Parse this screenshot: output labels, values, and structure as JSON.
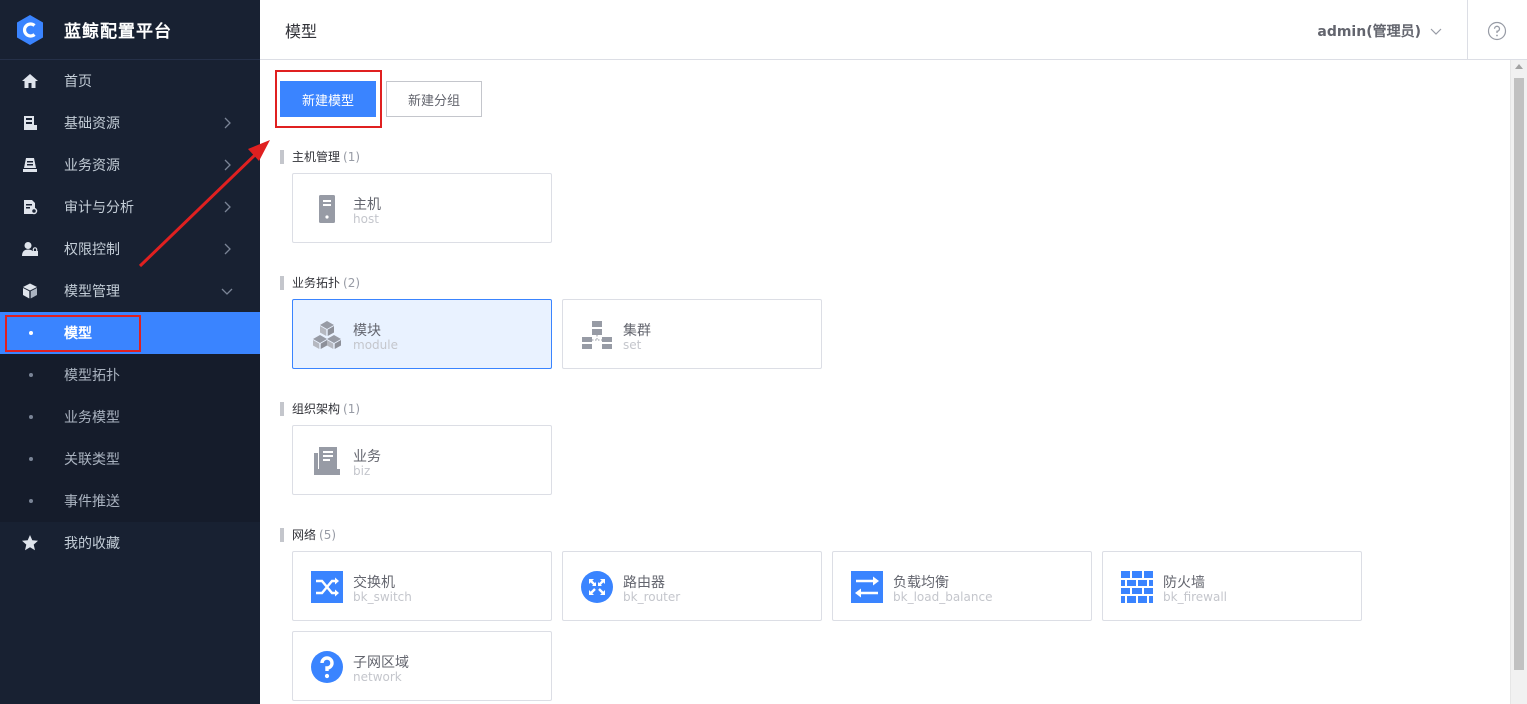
{
  "brand": {
    "name": "蓝鲸配置平台"
  },
  "sidebar": {
    "items": [
      {
        "label": "首页",
        "icon": "home-icon"
      },
      {
        "label": "基础资源",
        "icon": "resource-icon"
      },
      {
        "label": "业务资源",
        "icon": "business-resource-icon"
      },
      {
        "label": "审计与分析",
        "icon": "audit-icon"
      },
      {
        "label": "权限控制",
        "icon": "permission-icon"
      },
      {
        "label": "模型管理",
        "icon": "cube-icon"
      }
    ],
    "sub_items": [
      {
        "label": "模型"
      },
      {
        "label": "模型拓扑"
      },
      {
        "label": "业务模型"
      },
      {
        "label": "关联类型"
      },
      {
        "label": "事件推送"
      }
    ],
    "favorites": {
      "label": "我的收藏",
      "icon": "star-icon"
    }
  },
  "header": {
    "title": "模型",
    "user": "admin(管理员)"
  },
  "toolbar": {
    "new_model": "新建模型",
    "new_group": "新建分组"
  },
  "groups": [
    {
      "name": "主机管理",
      "count": "(1)",
      "models": [
        {
          "name": "主机",
          "id": "host",
          "icon": "host-icon"
        }
      ]
    },
    {
      "name": "业务拓扑",
      "count": "(2)",
      "models": [
        {
          "name": "模块",
          "id": "module",
          "icon": "module-icon"
        },
        {
          "name": "集群",
          "id": "set",
          "icon": "set-icon"
        }
      ]
    },
    {
      "name": "组织架构",
      "count": "(1)",
      "models": [
        {
          "name": "业务",
          "id": "biz",
          "icon": "biz-icon"
        }
      ]
    },
    {
      "name": "网络",
      "count": "(5)",
      "models": [
        {
          "name": "交换机",
          "id": "bk_switch",
          "icon": "switch-icon"
        },
        {
          "name": "路由器",
          "id": "bk_router",
          "icon": "router-icon"
        },
        {
          "name": "负载均衡",
          "id": "bk_load_balance",
          "icon": "load-balance-icon"
        },
        {
          "name": "防火墙",
          "id": "bk_firewall",
          "icon": "firewall-icon"
        },
        {
          "name": "子网区域",
          "id": "network",
          "icon": "question-icon"
        }
      ]
    }
  ],
  "colors": {
    "accent": "#3a84ff",
    "sidebar": "#182132",
    "highlight": "#e02020"
  }
}
